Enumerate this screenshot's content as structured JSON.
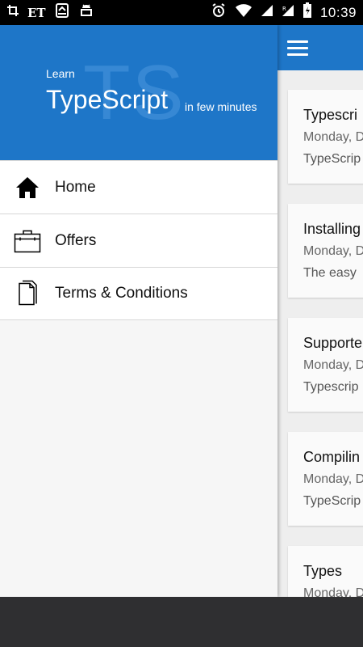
{
  "status_bar": {
    "et_label": "ET",
    "time": "10:39"
  },
  "drawer": {
    "header": {
      "watermark": "TS",
      "learn_label": "Learn",
      "title": "TypeScript",
      "tagline": "in few minutes"
    },
    "items": [
      {
        "label": "Home",
        "icon": "home-icon"
      },
      {
        "label": "Offers",
        "icon": "briefcase-icon"
      },
      {
        "label": "Terms & Conditions",
        "icon": "documents-icon"
      }
    ]
  },
  "cards": [
    {
      "title": "Typescri",
      "date": "Monday, D",
      "desc": "TypeScrip"
    },
    {
      "title": "Installing",
      "date": "Monday, D",
      "desc": "The easy"
    },
    {
      "title": "Supporte",
      "date": "Monday, D",
      "desc": "Typescrip"
    },
    {
      "title": "Compilin",
      "date": "Monday, D",
      "desc": "TypeScrip"
    },
    {
      "title": "Types",
      "date": "Monday, D",
      "desc": ""
    }
  ],
  "colors": {
    "primary": "#1e76c8",
    "drawer_bg": "#f6f6f6",
    "status_bar": "#000000",
    "nav_bar": "#2f2f31"
  }
}
